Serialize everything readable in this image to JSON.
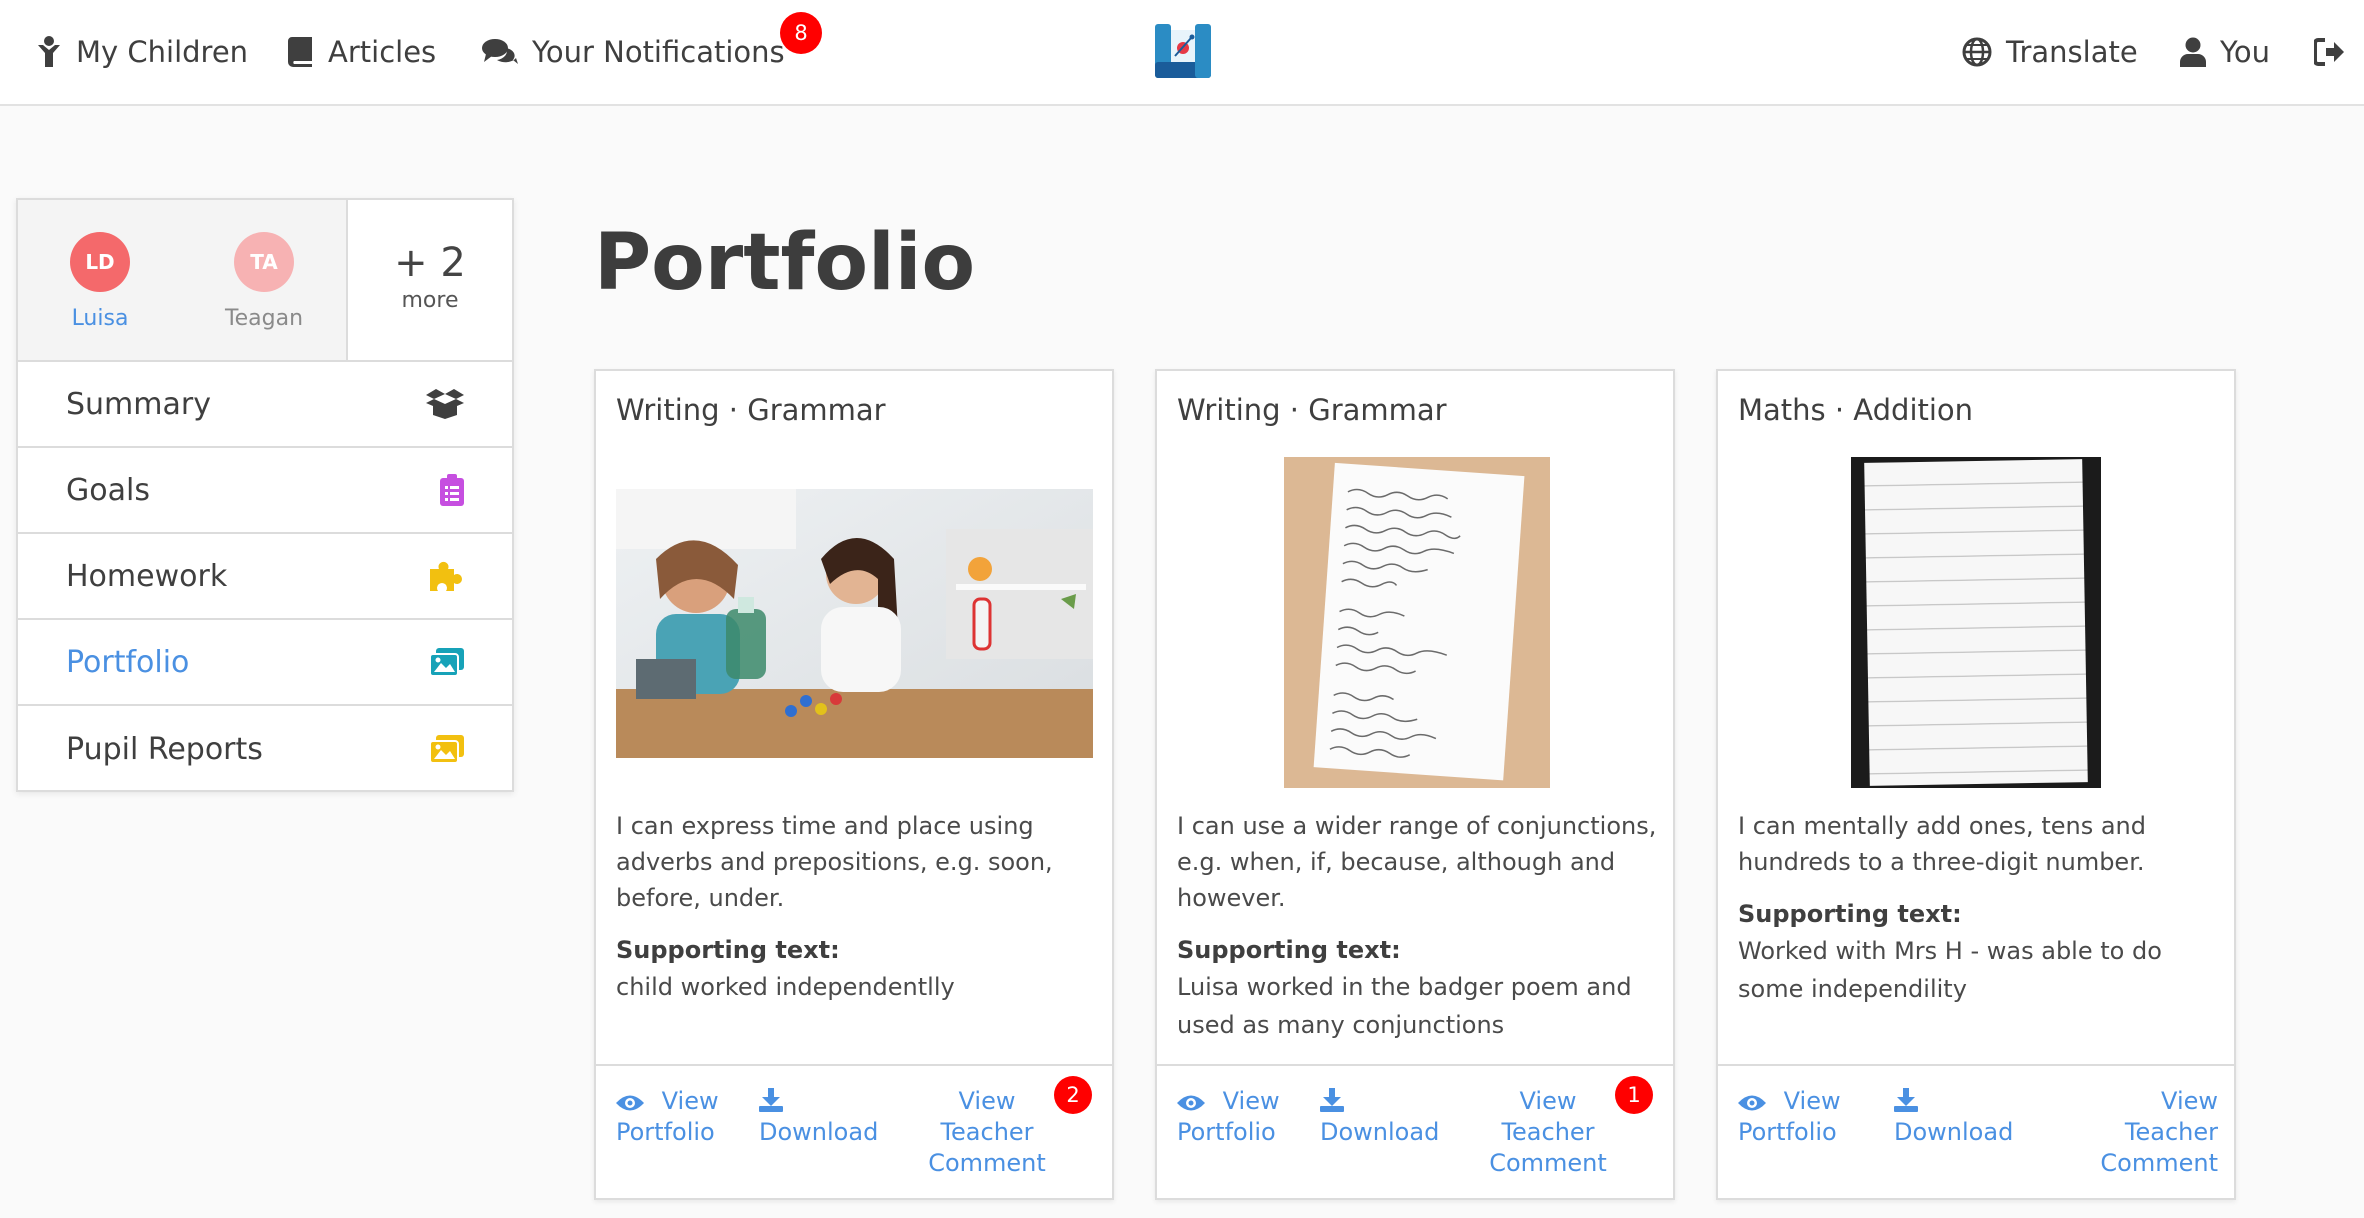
{
  "nav": {
    "my_children": "My Children",
    "articles": "Articles",
    "notifications": "Your Notifications",
    "notifications_count": "8",
    "translate": "Translate",
    "you": "You"
  },
  "sidebar": {
    "children": [
      {
        "initials": "LD",
        "name": "Luisa",
        "color": "#f4696b"
      },
      {
        "initials": "TA",
        "name": "Teagan",
        "color": "#f7b2b3"
      }
    ],
    "more_count": "+ 2",
    "more_label": "more",
    "menu": [
      {
        "label": "Summary",
        "icon": "box-open-icon",
        "color": "#3f3f3f"
      },
      {
        "label": "Goals",
        "icon": "clipboard-list-icon",
        "color": "#c64fe0"
      },
      {
        "label": "Homework",
        "icon": "puzzle-piece-icon",
        "color": "#f2c010"
      },
      {
        "label": "Portfolio",
        "icon": "images-icon",
        "color": "#17a2b8"
      },
      {
        "label": "Pupil Reports",
        "icon": "images-icon",
        "color": "#f2c010"
      }
    ]
  },
  "main": {
    "title": "Portfolio",
    "cards": [
      {
        "title": "Writing · Grammar",
        "description": "I can express time and place using adverbs and prepositions, e.g. soon, before, under.",
        "support_label": "Supporting text:",
        "support_text": "child worked independentlly",
        "comment_count": "2"
      },
      {
        "title": "Writing · Grammar",
        "description": "I can use a wider range of conjunctions, e.g. when, if, because, although and however.",
        "support_label": "Supporting text:",
        "support_text": "Luisa worked in the badger poem and used as many conjunctions",
        "comment_count": "1"
      },
      {
        "title": "Maths · Addition",
        "description": "I can mentally add ones, tens and hundreds to a three-digit number.",
        "support_label": "Supporting text:",
        "support_text": "Worked with Mrs H - was able to do some independility",
        "comment_count": ""
      }
    ],
    "actions": {
      "view_portfolio_1": "View",
      "view_portfolio_2": "Portfolio",
      "download": "Download",
      "teacher_1": "View",
      "teacher_2": "Teacher",
      "teacher_3": "Comment"
    }
  },
  "colors": {
    "accent": "#4a90e2",
    "badge": "#ff0000",
    "text": "#3f3f3f"
  }
}
